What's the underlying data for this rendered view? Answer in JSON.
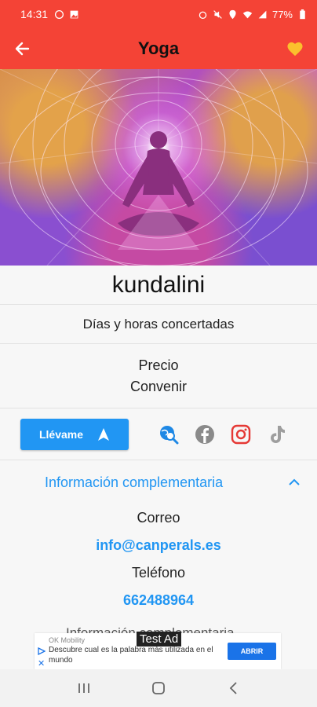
{
  "status_bar": {
    "time": "14:31",
    "battery": "77%"
  },
  "app_bar": {
    "title": "Yoga"
  },
  "hero": {
    "alt": "kundalini meditation illustration"
  },
  "place": {
    "name": "kundalini",
    "schedule": "Días y horas concertadas",
    "price_label": "Precio",
    "price_value": "Convenir"
  },
  "actions": {
    "go_label": "Llévame",
    "icons": [
      "web-search-icon",
      "facebook-icon",
      "instagram-icon",
      "tiktok-icon"
    ]
  },
  "section": {
    "title": "Información complementaria",
    "email_label": "Correo",
    "email_value": "info@canperals.es",
    "phone_label": "Teléfono",
    "phone_value": "662488964",
    "next_heading": "Información complementaria"
  },
  "ad": {
    "brand": "OK Mobility",
    "text": "Descubre cual es la palabra más utilizada en el mundo",
    "cta": "ABRIR",
    "badge": "Test Ad"
  },
  "colors": {
    "primary": "#f44336",
    "accent": "#2196f3",
    "heart": "#fbc02d"
  }
}
